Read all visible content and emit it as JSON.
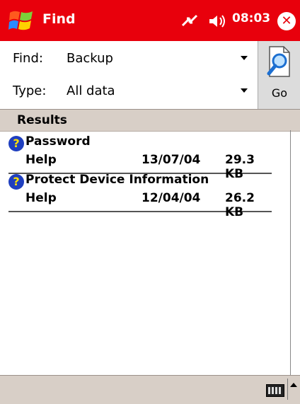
{
  "titlebar": {
    "app_title": "Find",
    "clock": "08:03",
    "icons": {
      "start": "windows-flag-icon",
      "connectivity": "connectivity-icon",
      "volume": "speaker-icon",
      "close": "close-icon"
    },
    "close_glyph": "✕"
  },
  "form": {
    "find_label": "Find:",
    "find_value": "Backup",
    "type_label": "Type:",
    "type_value": "All data",
    "go_label": "Go"
  },
  "results": {
    "header": "Results",
    "items": [
      {
        "title": "Password",
        "category": "Help",
        "date": "13/07/04",
        "size": "29.3 KB",
        "icon": "help-icon"
      },
      {
        "title": "Protect Device Information",
        "category": "Help",
        "date": "12/04/04",
        "size": "26.2 KB",
        "icon": "help-icon"
      }
    ]
  },
  "colors": {
    "titlebar": "#e8000c",
    "bar": "#d8cfc7",
    "help_icon": "#1f3fbf"
  }
}
